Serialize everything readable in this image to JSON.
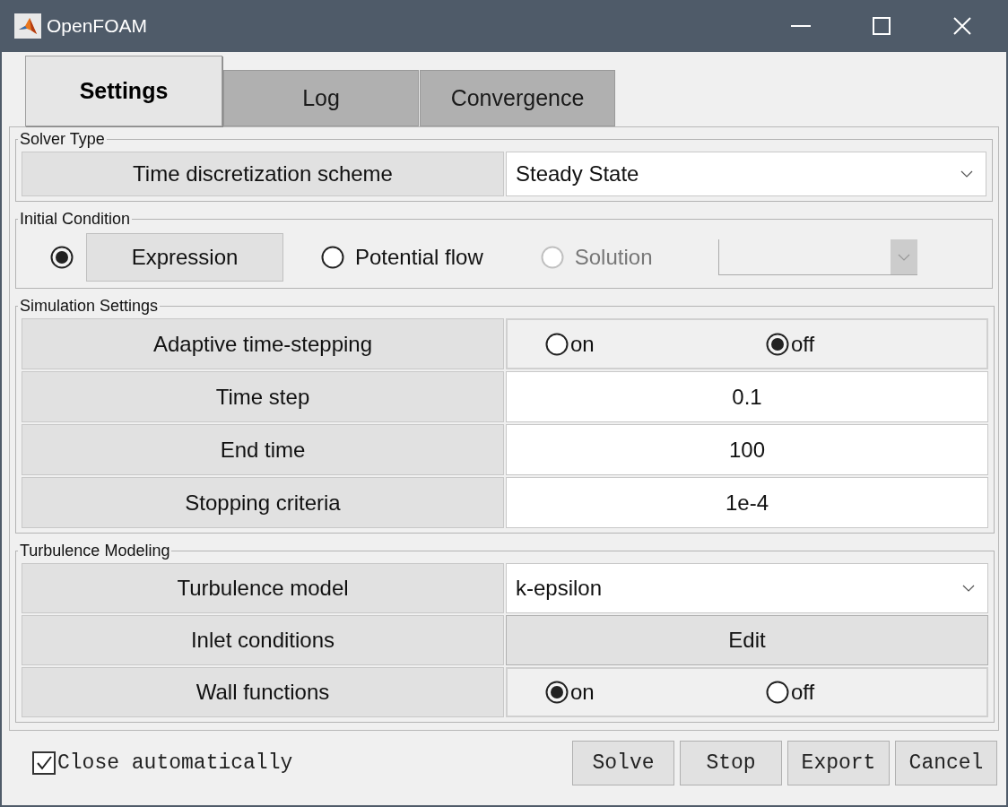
{
  "window": {
    "title": "OpenFOAM"
  },
  "tabs": [
    {
      "label": "Settings",
      "selected": true
    },
    {
      "label": "Log",
      "selected": false
    },
    {
      "label": "Convergence",
      "selected": false
    }
  ],
  "sections": [
    {
      "title": "Solver Type",
      "kind": "rows",
      "rows": [
        {
          "kind": "dropdown",
          "label": "Time discretization scheme",
          "value": "Steady State"
        }
      ]
    },
    {
      "title": "Initial Condition",
      "kind": "options",
      "options": [
        {
          "kind": "button",
          "label": "Expression",
          "selected": true,
          "disabled": false
        },
        {
          "kind": "text",
          "label": "Potential flow",
          "selected": false,
          "disabled": false
        },
        {
          "kind": "text",
          "label": "Solution",
          "selected": false,
          "disabled": true
        }
      ],
      "dropdown": {
        "disabled": true
      }
    },
    {
      "title": "Simulation Settings",
      "kind": "rows",
      "rows": [
        {
          "kind": "radio",
          "label": "Adaptive time-stepping",
          "options": [
            {
              "label": "on",
              "selected": false
            },
            {
              "label": "off",
              "selected": true
            }
          ]
        },
        {
          "kind": "value",
          "label": "Time step",
          "value": "0.1"
        },
        {
          "kind": "value",
          "label": "End time",
          "value": "100"
        },
        {
          "kind": "value",
          "label": "Stopping criteria",
          "value": "1e-4"
        }
      ]
    },
    {
      "title": "Turbulence Modeling",
      "kind": "rows",
      "rows": [
        {
          "kind": "dropdown",
          "label": "Turbulence model",
          "value": "k-epsilon"
        },
        {
          "kind": "button",
          "label": "Inlet conditions",
          "value": "Edit"
        },
        {
          "kind": "radio",
          "label": "Wall functions",
          "options": [
            {
              "label": "on",
              "selected": true
            },
            {
              "label": "off",
              "selected": false
            }
          ]
        }
      ]
    }
  ],
  "footer": {
    "checkbox": {
      "label": "Close automatically",
      "checked": true
    },
    "buttons": [
      "Solve",
      "Stop",
      "Export",
      "Cancel"
    ]
  }
}
